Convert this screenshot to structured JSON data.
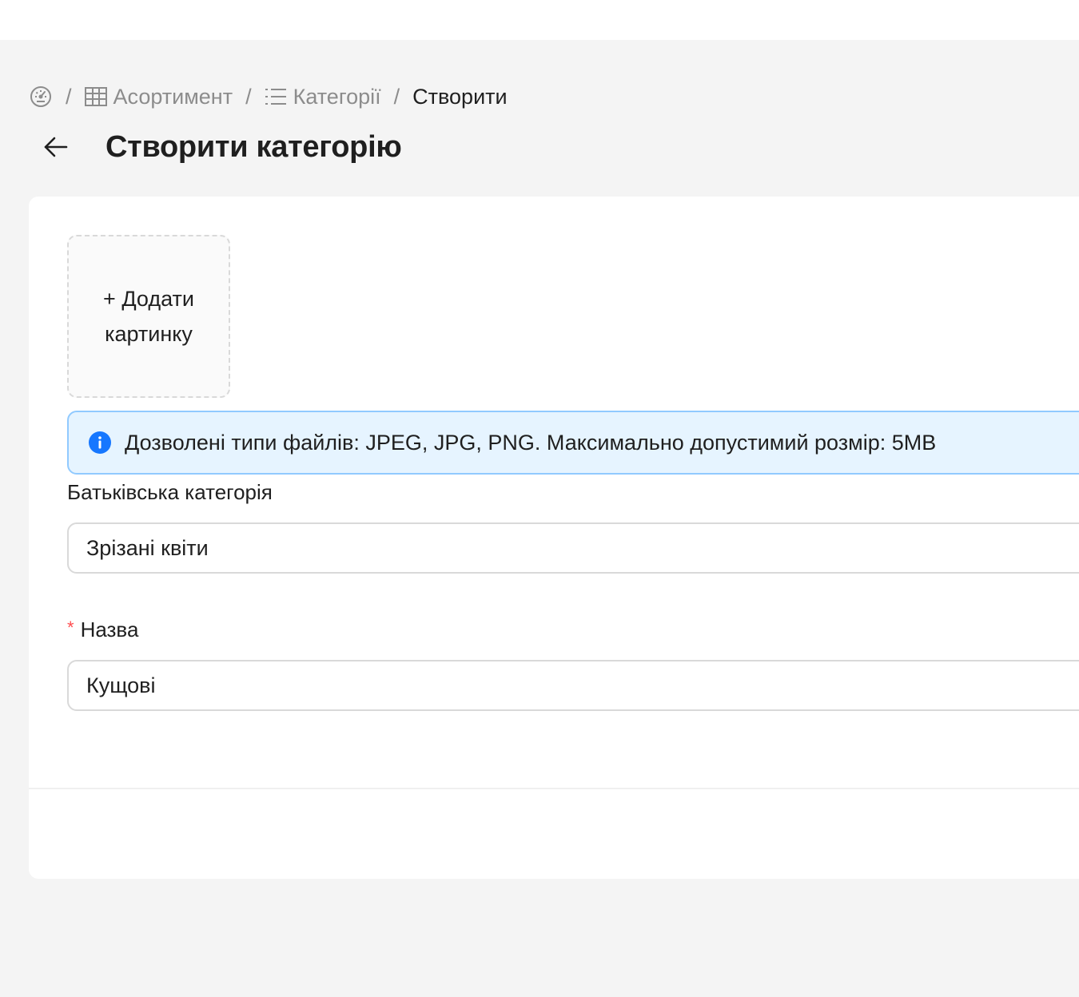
{
  "breadcrumb": {
    "home_icon": "dashboard-icon",
    "items": [
      {
        "label": "Асортимент",
        "icon": "table-icon"
      },
      {
        "label": "Категорії",
        "icon": "list-icon"
      },
      {
        "label": "Створити"
      }
    ],
    "separator": "/"
  },
  "header": {
    "back_icon": "arrow-left-icon",
    "title": "Створити категорію"
  },
  "upload": {
    "line1": "+ Додати",
    "line2": "картинку"
  },
  "alert": {
    "icon": "info-icon",
    "text": "Дозволені типи файлів: JPEG, JPG, PNG. Максимально допустимий розмір: 5MB",
    "colors": {
      "background": "#e6f4ff",
      "border": "#91caff",
      "icon": "#1677ff"
    }
  },
  "form": {
    "parent_category": {
      "label": "Батьківська категорія",
      "value": "Зрізані квіти"
    },
    "name": {
      "required_mark": "*",
      "label": "Назва",
      "value": "Кущові"
    }
  }
}
